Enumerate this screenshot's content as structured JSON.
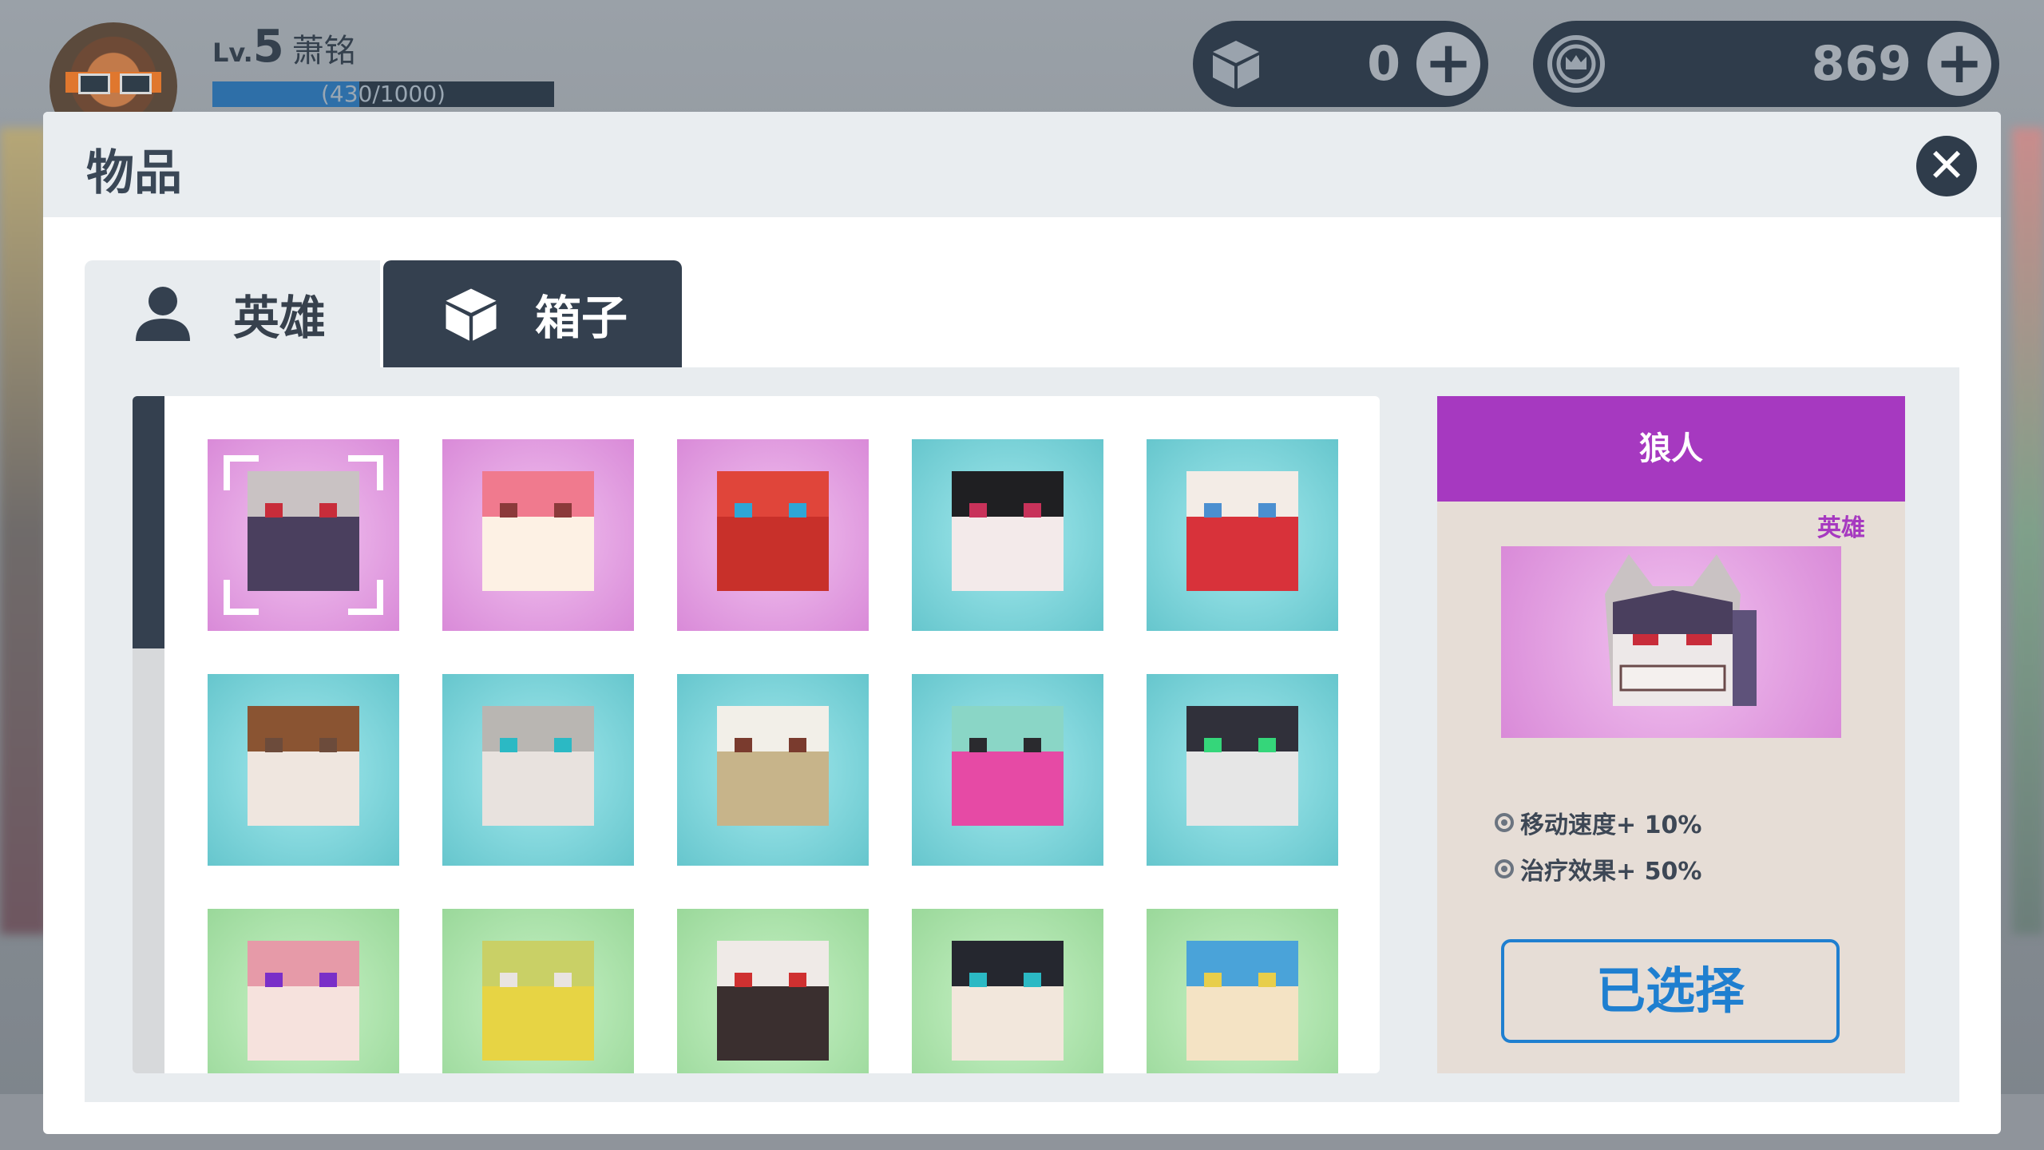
{
  "player": {
    "level_prefix": "Lv.",
    "level": "5",
    "name": "萧铭",
    "xp_text": "(430/1000)",
    "xp_progress": 0.43
  },
  "currencies": [
    {
      "icon": "box-icon",
      "value": "0"
    },
    {
      "icon": "crown-coin-icon",
      "value": "869"
    }
  ],
  "panel": {
    "title": "物品",
    "tabs": [
      {
        "label": "英雄",
        "icon": "person-icon",
        "active": false
      },
      {
        "label": "箱子",
        "icon": "box-icon",
        "active": true
      }
    ]
  },
  "items": [
    {
      "bg": "pink",
      "character": "werewolf",
      "selected": true
    },
    {
      "bg": "pink",
      "character": "teeth-monster"
    },
    {
      "bg": "pink",
      "character": "red-robot"
    },
    {
      "bg": "teal",
      "character": "black-hair-girl"
    },
    {
      "bg": "teal",
      "character": "clown"
    },
    {
      "bg": "teal",
      "character": "cowboy"
    },
    {
      "bg": "teal",
      "character": "knight"
    },
    {
      "bg": "teal",
      "character": "priest"
    },
    {
      "bg": "teal",
      "character": "punk"
    },
    {
      "bg": "teal",
      "character": "skull-mask"
    },
    {
      "bg": "green",
      "character": "pink-hair-girl"
    },
    {
      "bg": "green",
      "character": "frog-king"
    },
    {
      "bg": "green",
      "character": "skeleton"
    },
    {
      "bg": "green",
      "character": "captain"
    },
    {
      "bg": "green",
      "character": "blue-cap"
    }
  ],
  "detail": {
    "name": "狼人",
    "type": "英雄",
    "stats": [
      "移动速度+ 10%",
      "治疗效果+ 50%"
    ],
    "button": "已选择"
  },
  "colors": {
    "accent_purple": "#a639c0",
    "dark_slate": "#34404f",
    "button_blue": "#1f7fd0"
  }
}
